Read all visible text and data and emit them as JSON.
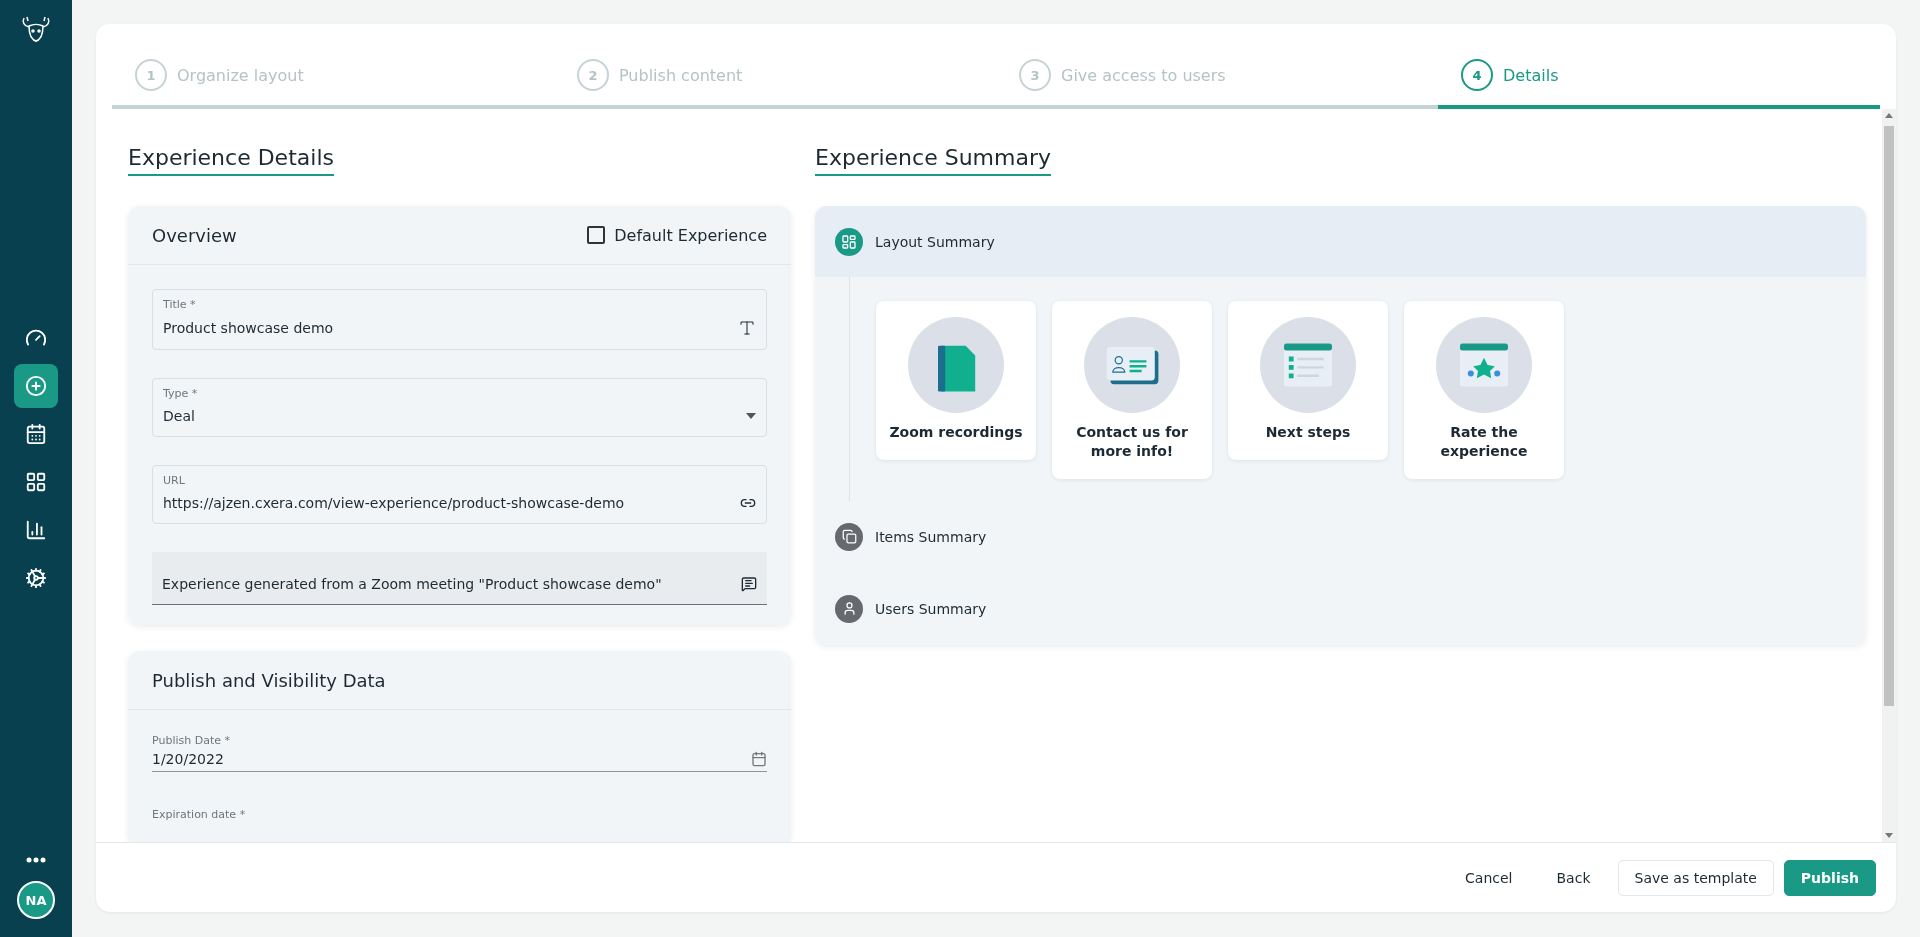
{
  "sidebar": {
    "nav_items": [
      {
        "kind": "dashboard",
        "selected": false
      },
      {
        "kind": "create",
        "selected": true
      },
      {
        "kind": "calendar",
        "selected": false
      },
      {
        "kind": "apps",
        "selected": false
      },
      {
        "kind": "chart",
        "selected": false
      },
      {
        "kind": "settings",
        "selected": false
      }
    ],
    "avatar": "NA"
  },
  "steps": [
    {
      "number": "1",
      "label": "Organize layout",
      "selected": false
    },
    {
      "number": "2",
      "label": "Publish content",
      "selected": false
    },
    {
      "number": "3",
      "label": "Give access to users",
      "selected": false
    },
    {
      "number": "4",
      "label": "Details",
      "selected": true
    }
  ],
  "details": {
    "heading": "Experience Details",
    "overview": {
      "title": "Overview",
      "default_experience": {
        "label": "Default Experience",
        "checked": false
      },
      "fields": [
        {
          "kind": "text",
          "label": "Title *",
          "value": "Product showcase demo"
        },
        {
          "kind": "select",
          "label": "Type *",
          "value": "Deal"
        },
        {
          "kind": "url",
          "label": "URL",
          "value": "https://ajzen.cxera.com/view-experience/product-showcase-demo"
        },
        {
          "kind": "note",
          "value": "Experience generated from a Zoom meeting \"Product showcase demo\""
        }
      ]
    },
    "publish": {
      "title": "Publish and Visibility Data",
      "fields": [
        {
          "kind": "date",
          "label": "Publish Date *",
          "value": "1/20/2022"
        },
        {
          "kind": "date",
          "label": "Expiration date *"
        }
      ]
    }
  },
  "summary": {
    "heading": "Experience Summary",
    "sections": [
      {
        "kind": "layout",
        "label": "Layout Summary",
        "expanded": true,
        "cards": [
          {
            "kind": "notebook",
            "title": "Zoom recordings"
          },
          {
            "kind": "contact",
            "title": "Contact us for more info!"
          },
          {
            "kind": "checklist",
            "title": "Next steps"
          },
          {
            "kind": "rating",
            "title": "Rate the experience"
          }
        ]
      },
      {
        "kind": "items",
        "label": "Items Summary",
        "expanded": false
      },
      {
        "kind": "users",
        "label": "Users Summary",
        "expanded": false
      }
    ]
  },
  "footer": {
    "buttons": [
      {
        "kind": "text",
        "label": "Cancel"
      },
      {
        "kind": "text",
        "label": "Back"
      },
      {
        "kind": "outlined",
        "label": "Save as template"
      },
      {
        "kind": "primary",
        "label": "Publish"
      }
    ]
  }
}
